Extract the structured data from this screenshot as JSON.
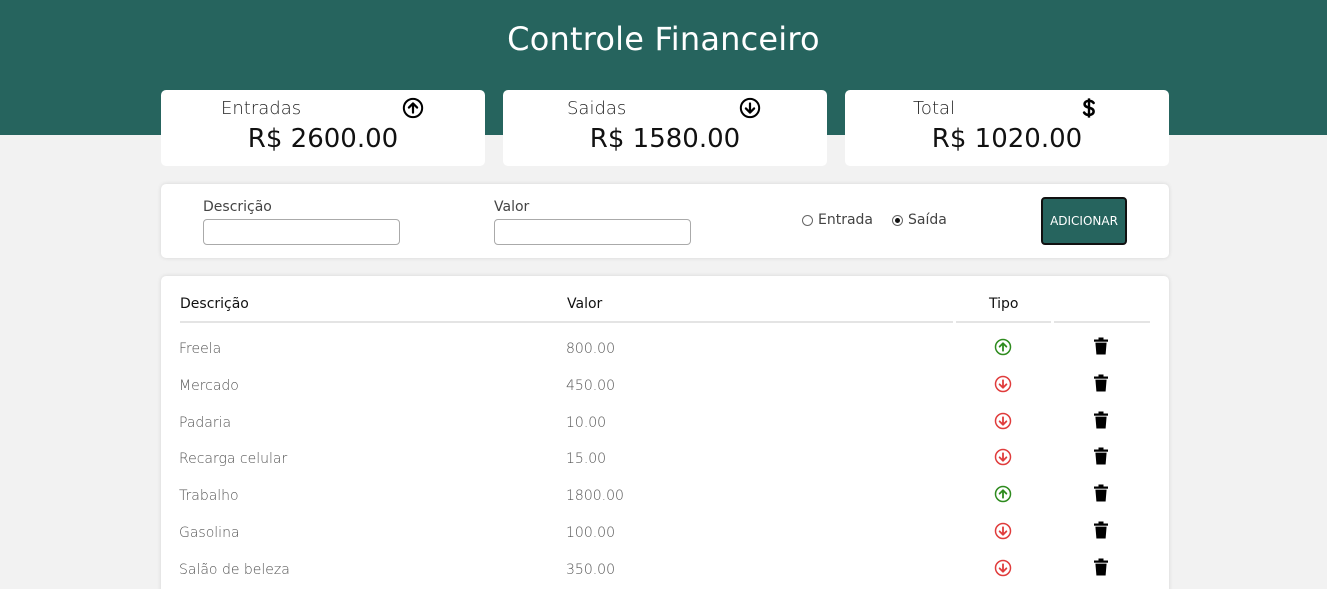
{
  "app": {
    "title": "Controle Financeiro"
  },
  "summary": [
    {
      "label": "Entradas",
      "value": "R$ 2600.00",
      "icon": "arrow-up-circle-icon"
    },
    {
      "label": "Saidas",
      "value": "R$ 1580.00",
      "icon": "arrow-down-circle-icon"
    },
    {
      "label": "Total",
      "value": "R$ 1020.00",
      "icon": "dollar-icon"
    }
  ],
  "form": {
    "description_label": "Descrição",
    "description_value": "",
    "value_label": "Valor",
    "value_value": "",
    "radio_entrada": "Entrada",
    "radio_saida": "Saída",
    "selected_type": "Saída",
    "add_button": "ADICIONAR"
  },
  "table": {
    "headers": {
      "description": "Descrição",
      "value": "Valor",
      "type": "Tipo"
    },
    "rows": [
      {
        "description": "Freela",
        "value": "800.00",
        "type": "entrada"
      },
      {
        "description": "Mercado",
        "value": "450.00",
        "type": "saida"
      },
      {
        "description": "Padaria",
        "value": "10.00",
        "type": "saida"
      },
      {
        "description": "Recarga celular",
        "value": "15.00",
        "type": "saida"
      },
      {
        "description": "Trabalho",
        "value": "1800.00",
        "type": "entrada"
      },
      {
        "description": "Gasolina",
        "value": "100.00",
        "type": "saida"
      },
      {
        "description": "Salão de beleza",
        "value": "350.00",
        "type": "saida"
      }
    ]
  },
  "colors": {
    "header_bg": "#26645e",
    "entrada_icon": "#2e8b1e",
    "saida_icon": "#e03c3c"
  }
}
